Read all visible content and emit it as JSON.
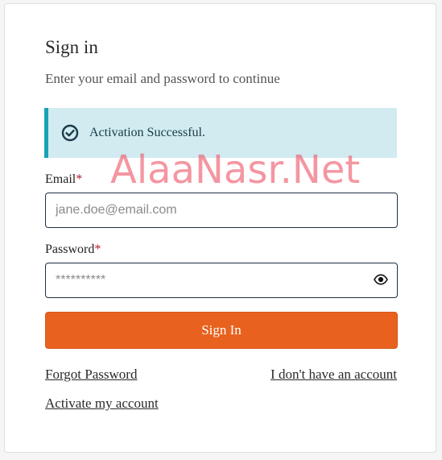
{
  "signin": {
    "title": "Sign in",
    "subtitle": "Enter your email and password to continue"
  },
  "alert": {
    "icon": "check-circle-icon",
    "message": "Activation Successful.",
    "bg_color": "#d1ebf1",
    "border_color": "#17a2b8"
  },
  "form": {
    "email_label": "Email",
    "email_required": "*",
    "email_placeholder": "jane.doe@email.com",
    "password_label": "Password",
    "password_required": "*",
    "password_value": "**********",
    "password_toggle_icon": "eye-icon"
  },
  "actions": {
    "signin_label": "Sign In",
    "signin_color": "#e8611e",
    "forgot_password": "Forgot Password",
    "no_account": "I don't have an account",
    "activate_account": "Activate my account"
  },
  "watermark": {
    "text": "AlaaNasr.Net"
  }
}
